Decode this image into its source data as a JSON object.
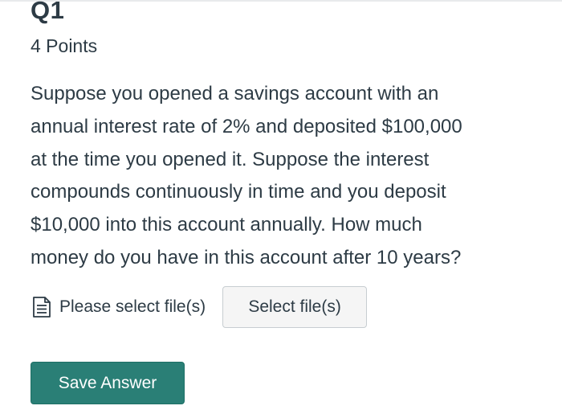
{
  "question": {
    "number": "Q1",
    "points": "4 Points",
    "body_lines": [
      "Suppose you opened a savings account with an",
      "annual interest rate of 2% and deposited $100,000",
      "at the time you opened it. Suppose the interest",
      "compounds continuously in time and you deposit",
      "$10,000 into this account annually. How much",
      "money do you have in this account after 10 years?"
    ]
  },
  "upload": {
    "icon": "file-icon",
    "label": "Please select file(s)",
    "button_label": "Select file(s)"
  },
  "actions": {
    "save_label": "Save Answer"
  },
  "colors": {
    "text": "#2d3b45",
    "save_button": "#2a7f76",
    "select_button_bg": "#f5f5f5",
    "select_button_border": "#c7cdd1"
  }
}
